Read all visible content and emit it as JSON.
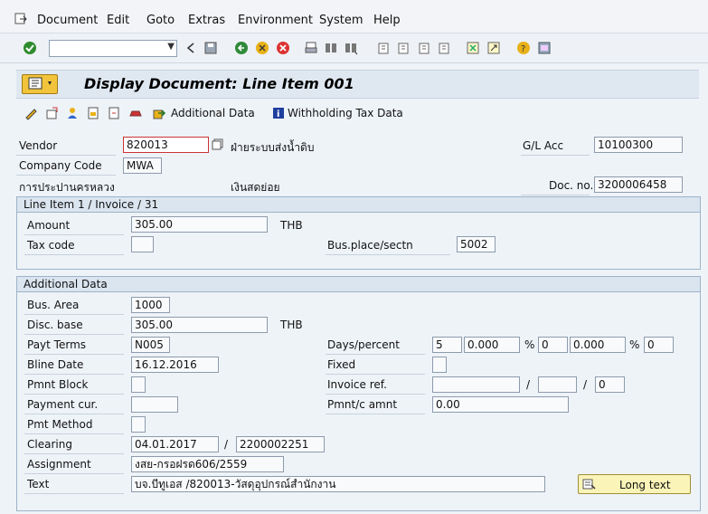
{
  "menu": [
    "Document",
    "Edit",
    "Goto",
    "Extras",
    "Environment",
    "System",
    "Help"
  ],
  "title": "Display Document: Line Item 001",
  "appbar": {
    "additional_data": "Additional Data",
    "withholding": "Withholding Tax Data"
  },
  "header": {
    "vendor_label": "Vendor",
    "vendor_value": "820013",
    "vendor_name": "ฝ่ายระบบส่งน้ำดิบ",
    "gl_label": "G/L Acc",
    "gl_value": "10100300",
    "company_label": "Company Code",
    "company_value": "MWA",
    "company_name": "การประปานครหลวง",
    "vendor_city": "เงินสดย่อย",
    "docno_label": "Doc. no.",
    "docno_value": "3200006458"
  },
  "lineitem": {
    "title": "Line Item 1 / Invoice / 31",
    "amount_label": "Amount",
    "amount_value": "305.00",
    "amount_cur": "THB",
    "taxcode_label": "Tax code",
    "taxcode_value": "",
    "busplace_label": "Bus.place/sectn",
    "busplace_value": "5002"
  },
  "additional": {
    "title": "Additional Data",
    "busarea_label": "Bus. Area",
    "busarea_value": "1000",
    "discbase_label": "Disc. base",
    "discbase_value": "305.00",
    "discbase_cur": "THB",
    "payt_label": "Payt Terms",
    "payt_value": "N005",
    "days_label": "Days/percent",
    "days1": "5",
    "pct1": "0.000",
    "pct_sign": "%",
    "days2": "0",
    "pct2": "0.000",
    "days3": "0",
    "bline_label": "Bline Date",
    "bline_value": "16.12.2016",
    "fixed_label": "Fixed",
    "pmtblock_label": "Pmnt Block",
    "invref_label": "Invoice ref.",
    "slash": "/",
    "invref3": "0",
    "paycur_label": "Payment cur.",
    "pmntc_label": "Pmnt/c amnt",
    "pmntc_value": "0.00",
    "pmtmethod_label": "Pmt Method",
    "clearing_label": "Clearing",
    "clearing_date": "04.01.2017",
    "clearing_doc": "2200002251",
    "assignment_label": "Assignment",
    "assignment_value": "งสย-กรอฝรด606/2559",
    "text_label": "Text",
    "text_value": "บจ.บีทูเอส  /820013-วัสดุอุปกรณ์สำนักงาน",
    "longtext_label": "Long text"
  }
}
